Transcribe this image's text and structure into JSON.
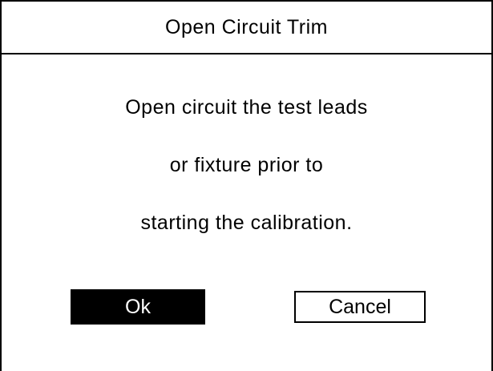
{
  "dialog": {
    "title": "Open Circuit Trim",
    "message_lines": [
      "Open circuit the test leads",
      "or fixture prior to",
      "starting the calibration."
    ],
    "ok_label": "Ok",
    "cancel_label": "Cancel",
    "focused_button": "ok"
  },
  "colors": {
    "background": "#ffffff",
    "foreground": "#000000",
    "selected_button_bg": "#000000",
    "selected_button_text": "#ffffff"
  }
}
